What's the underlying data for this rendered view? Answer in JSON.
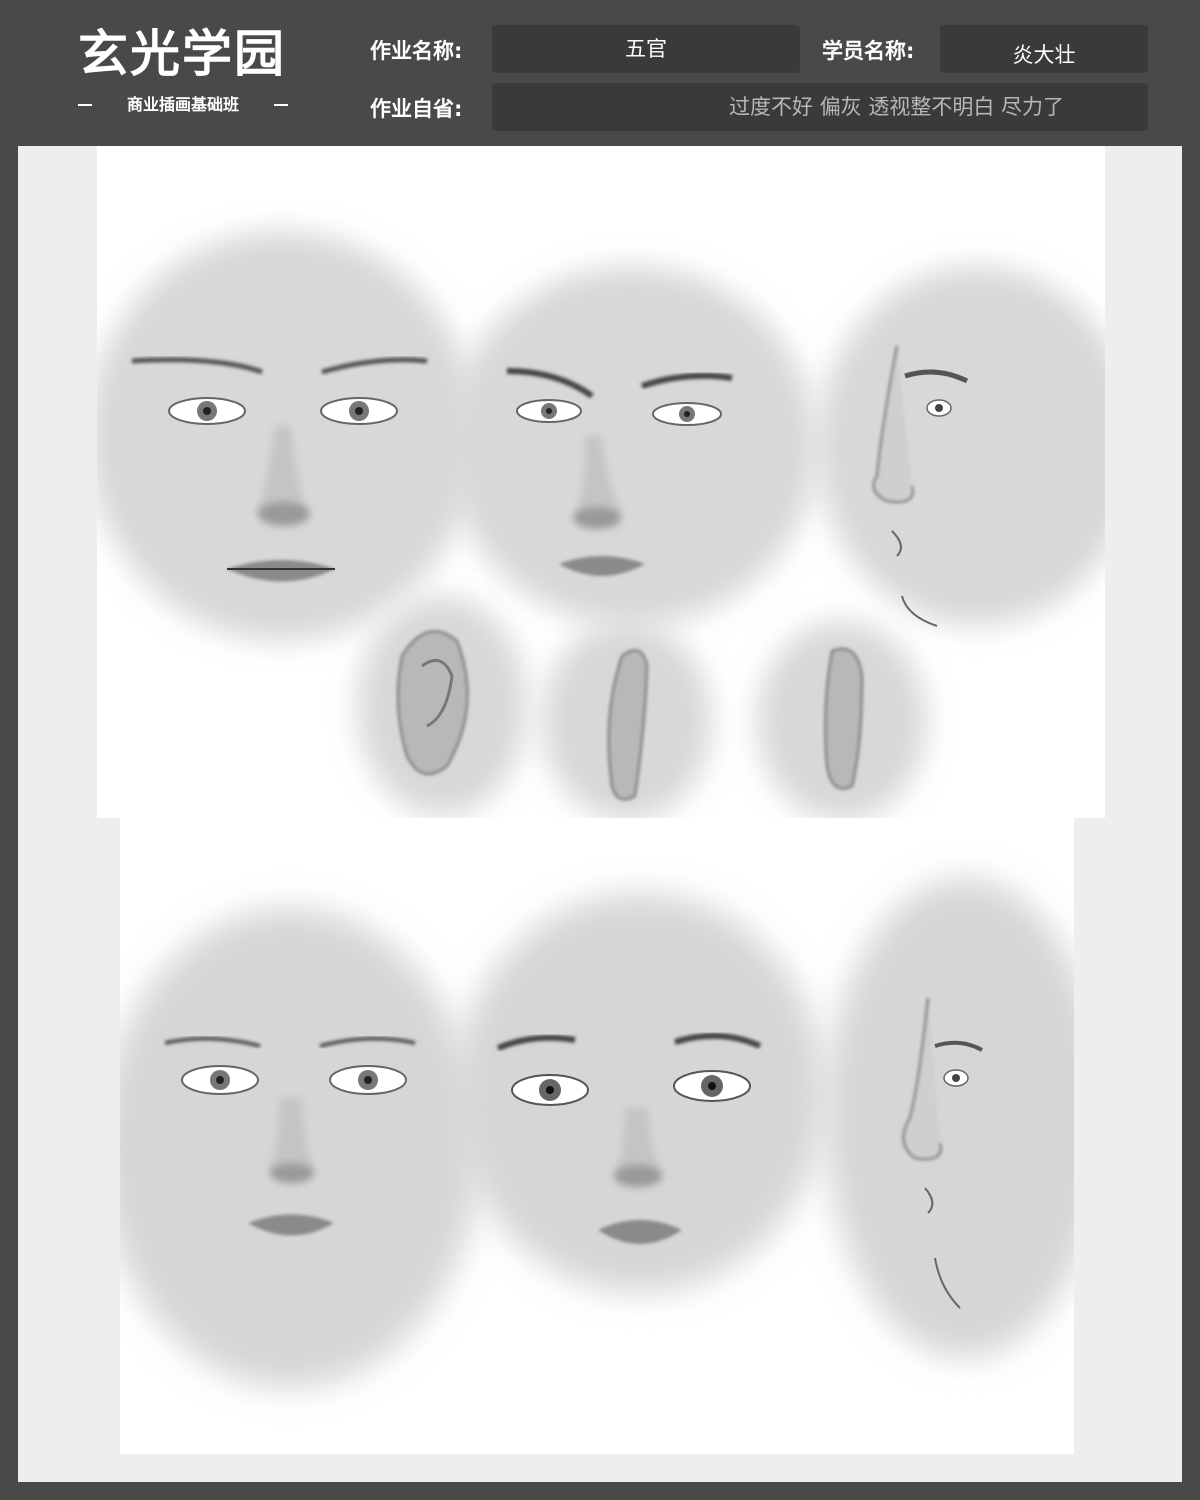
{
  "logo": {
    "title": "玄光学园",
    "subtitle": "商业插画基础班"
  },
  "form": {
    "assignment_label": "作业名称:",
    "assignment_value": "五官",
    "student_label": "学员名称:",
    "student_value": "炎大壮",
    "reflection_label": "作业自省:",
    "reflection_value": "过度不好  偏灰  透视整不明白  尽力了"
  },
  "colors": {
    "frame": "#4a494a",
    "field_bg": "#3b3a3b",
    "canvas_bg": "#eeeeee",
    "sheet_bg": "#ffffff"
  }
}
